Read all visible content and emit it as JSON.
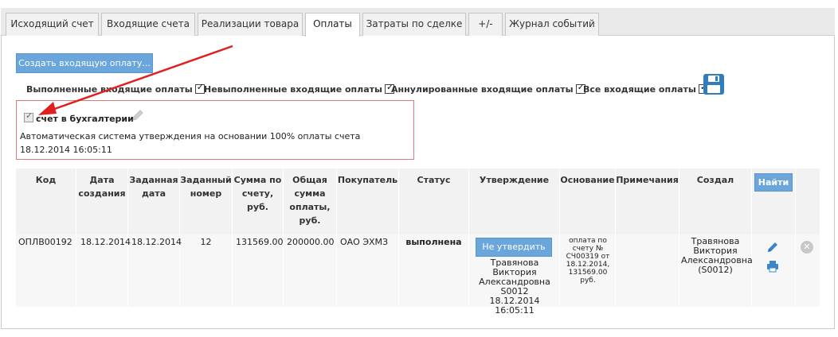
{
  "tabs": [
    {
      "label": "Исходящий счет"
    },
    {
      "label": "Входящие счета"
    },
    {
      "label": "Реализации товара"
    },
    {
      "label": "Оплаты"
    },
    {
      "label": "Затраты по сделке"
    },
    {
      "label": "+/-"
    },
    {
      "label": "Журнал событий"
    }
  ],
  "active_tab": "Оплаты",
  "toolbar": {
    "create_label": "Создать входящую оплату...",
    "save_icon": "floppy-disk-icon"
  },
  "filters": [
    {
      "label": "Выполненные входящие оплаты",
      "checked": true
    },
    {
      "label": "Невыполненные входящие оплаты",
      "checked": true
    },
    {
      "label": "Аннулированные входящие оплаты",
      "checked": true
    },
    {
      "label": "Все входящие оплаты",
      "checked": true
    }
  ],
  "notice": {
    "checkbox_label": "счет в бухгалтерии",
    "checked": true,
    "message": "Автоматическая система утверждения на основании 100% оплаты счета 18.12.2014 16:05:11"
  },
  "table": {
    "headers": {
      "code": "Код",
      "created": "Дата создания",
      "set_date": "Заданная дата",
      "set_number": "Заданный номер",
      "sum_invoice": "Сумма по счету, руб.",
      "total_paid": "Общая сумма оплаты, руб.",
      "buyer": "Покупатель",
      "status": "Статус",
      "approval": "Утверждение",
      "basis": "Основание",
      "notes": "Примечания",
      "author": "Создал"
    },
    "find_label": "Найти",
    "rows": [
      {
        "code": "ОПЛВ00192",
        "created": "18.12.2014",
        "set_date": "18.12.2014",
        "set_number": "12",
        "sum_invoice": "131569.00",
        "total_paid": "200000.00",
        "buyer": "ОАО ЭХМЗ",
        "status": "выполнена",
        "approval_button": "Не утвердить",
        "approval_info": "Травянова Виктория Александровна S0012 18.12.2014 16:05:11",
        "basis": "оплата по счету № СЧ00319 от 18.12.2014, 131569.00 руб.",
        "notes": "",
        "author": "Травянова Виктория Александровна (S0012)"
      }
    ]
  },
  "colors": {
    "accent": "#6aa6dc",
    "highlight_border": "#e07a7a",
    "arrow": "#e02020"
  }
}
